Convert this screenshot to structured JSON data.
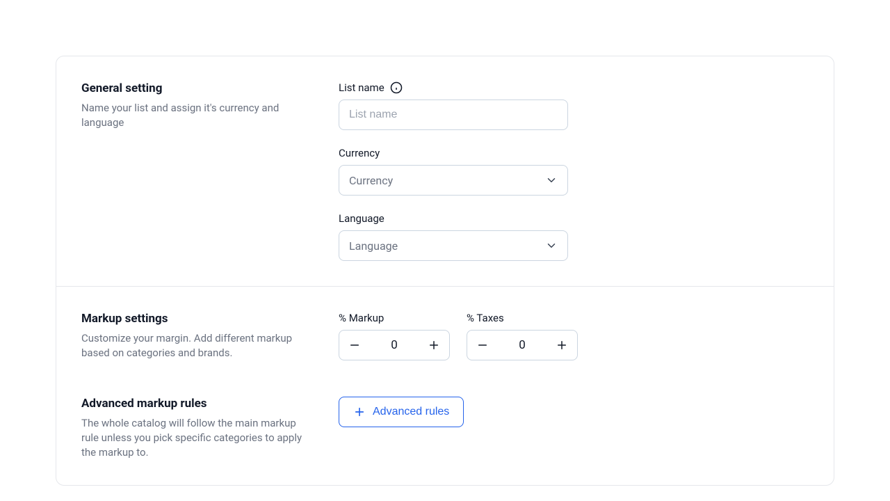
{
  "general": {
    "title": "General setting",
    "description": "Name your list and assign it's currency and language",
    "list_name_label": "List name",
    "list_name_placeholder": "List name",
    "currency_label": "Currency",
    "currency_placeholder": "Currency",
    "language_label": "Language",
    "language_placeholder": "Language"
  },
  "markup": {
    "title": "Markup settings",
    "description": "Customize your margin. Add different markup based on categories and brands.",
    "markup_label": "% Markup",
    "markup_value": "0",
    "taxes_label": "% Taxes",
    "taxes_value": "0"
  },
  "advanced": {
    "title": "Advanced markup rules",
    "description": "The whole catalog will follow the main markup rule unless you pick specific categories to apply the markup to.",
    "button_label": "Advanced rules"
  }
}
